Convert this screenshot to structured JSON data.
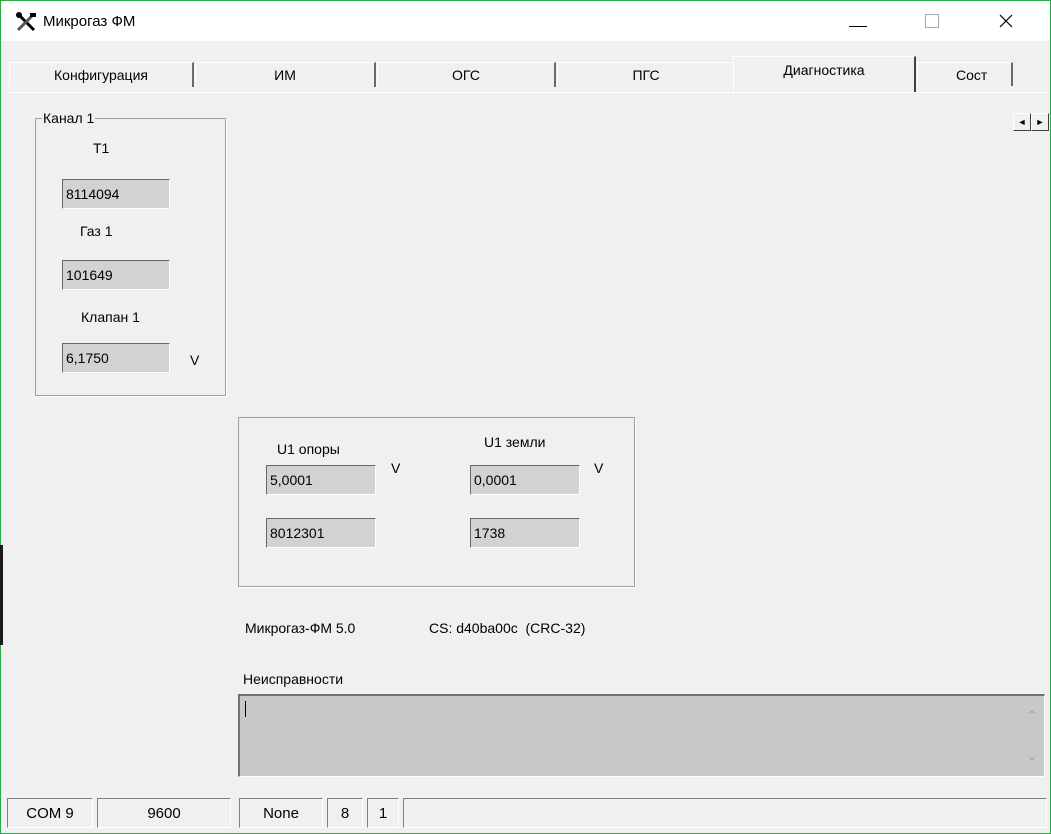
{
  "window": {
    "title": "Микрогаз ФМ",
    "controls": {
      "minimize": "–",
      "maximize": "□",
      "close": "✕"
    }
  },
  "tabs": [
    {
      "label": "Конфигурация",
      "active": false
    },
    {
      "label": "ИМ",
      "active": false
    },
    {
      "label": "ОГС",
      "active": false
    },
    {
      "label": "ПГС",
      "active": false
    },
    {
      "label": "Диагностика",
      "active": true
    },
    {
      "label": "Сост",
      "active": false
    }
  ],
  "tab_scroll": {
    "left": "◄",
    "right": "►"
  },
  "channel": {
    "title": "Канал 1",
    "t_label": "Т1",
    "t_value": "8114094",
    "gas_label": "Газ 1",
    "gas_value": "101649",
    "valve_label": "Клапан 1",
    "valve_value": "6,1750",
    "valve_unit": "V"
  },
  "voltages": {
    "ref_label": "U1 опоры",
    "ref_value": "5,0001",
    "ref_unit": "V",
    "ref_raw": "8012301",
    "ground_label": "U1 земли",
    "ground_value": "0,0001",
    "ground_unit": "V",
    "ground_raw": "1738"
  },
  "version": {
    "product": "Микрогаз-ФМ 5.0",
    "checksum": "CS: d40ba00c  (CRC-32)"
  },
  "faults": {
    "label": "Неисправности",
    "value": "",
    "scroll_up": "⌃",
    "scroll_down": "⌄"
  },
  "status": {
    "port": "COM 9",
    "baud": "9600",
    "parity": "None",
    "data_bits": "8",
    "stop_bits": "1"
  }
}
